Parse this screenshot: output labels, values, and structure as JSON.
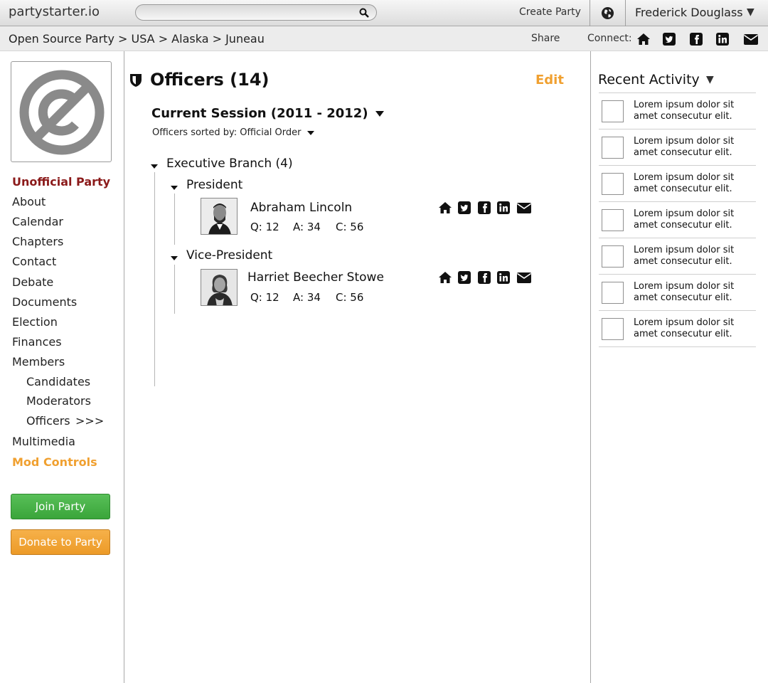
{
  "topbar": {
    "logo": "partystarter.io",
    "search_placeholder": "",
    "create_party": "Create Party",
    "user_name": "Frederick Douglass",
    "user_caret": "▼"
  },
  "crumbbar": {
    "breadcrumb": "Open Source Party > USA > Alaska > Juneau",
    "share": "Share",
    "connect": "Connect:"
  },
  "sidebar": {
    "party_status": "Unofficial Party",
    "items": [
      "About",
      "Calendar",
      "Chapters",
      "Contact",
      "Debate",
      "Documents",
      "Election",
      "Finances",
      "Members"
    ],
    "subitems": [
      "Candidates",
      "Moderators",
      "Officers"
    ],
    "officers_marker": ">>>",
    "multimedia": "Multimedia",
    "mod_controls": "Mod Controls",
    "join_button": "Join Party",
    "donate_button": "Donate to Party"
  },
  "main": {
    "title": "Officers (14)",
    "edit": "Edit",
    "session": "Current Session (2011 - 2012)",
    "sorted_by": "Officers sorted by: Official Order",
    "branch": "Executive Branch (4)",
    "roles": [
      {
        "title": "President",
        "officer": {
          "name": "Abraham Lincoln",
          "q": "Q: 12",
          "a": "A: 34",
          "c": "C: 56"
        }
      },
      {
        "title": "Vice-President",
        "officer": {
          "name": "Harriet Beecher Stowe",
          "q": "Q: 12",
          "a": "A: 34",
          "c": "C: 56"
        }
      }
    ]
  },
  "recent": {
    "title": "Recent Activity",
    "caret": "▼",
    "items": [
      "Lorem ipsum dolor sit amet consecutur elit.",
      "Lorem ipsum dolor sit amet consecutur elit.",
      "Lorem ipsum dolor sit amet consecutur elit.",
      "Lorem ipsum dolor sit amet consecutur elit.",
      "Lorem ipsum dolor sit amet consecutur elit.",
      "Lorem ipsum dolor sit amet consecutur elit.",
      "Lorem ipsum dolor sit amet consecutur elit."
    ]
  },
  "colors": {
    "accent_orange": "#f0a030",
    "party_red": "#8b1a1a",
    "join_green": "#3aa53a",
    "donate_orange": "#ec9a28"
  }
}
